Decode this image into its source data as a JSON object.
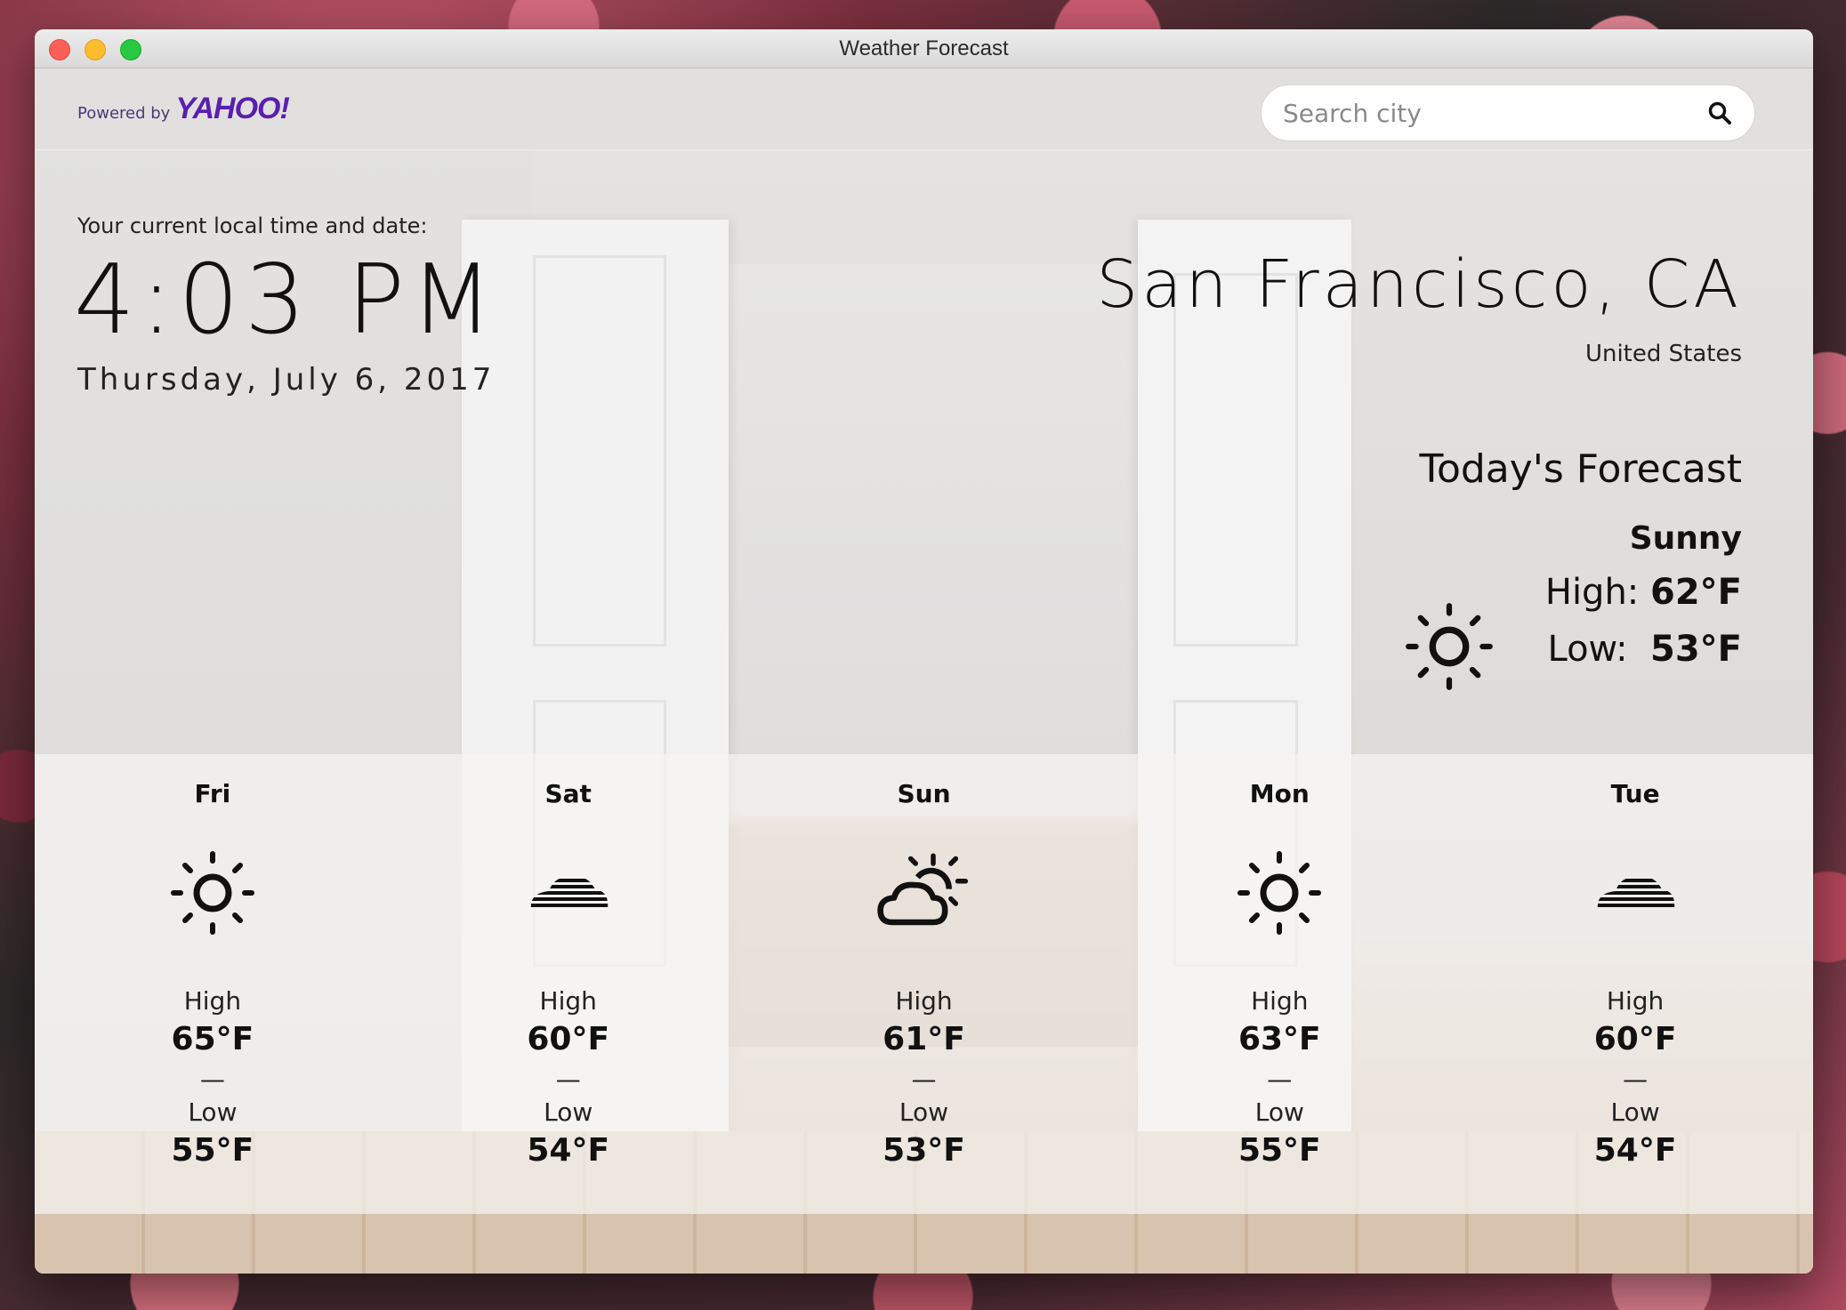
{
  "window": {
    "title": "Weather Forecast"
  },
  "header": {
    "powered_by": "Powered by",
    "brand": "YAHOO!",
    "search": {
      "placeholder": "Search city",
      "value": ""
    }
  },
  "local": {
    "label": "Your current local time and date:",
    "time": "4:03 PM",
    "date": "Thursday, July 6, 2017"
  },
  "location": {
    "city": "San Francisco, CA",
    "country": "United States"
  },
  "today": {
    "title": "Today's Forecast",
    "condition": "Sunny",
    "high_label": "High:",
    "high": "62°F",
    "low_label": "Low:",
    "low": "53°F",
    "icon": "sun-icon"
  },
  "forecast": [
    {
      "day": "Fri",
      "icon": "sun-icon",
      "high_label": "High",
      "high": "65°F",
      "dash": "—",
      "low_label": "Low",
      "low": "55°F"
    },
    {
      "day": "Sat",
      "icon": "cloud-icon",
      "high_label": "High",
      "high": "60°F",
      "dash": "—",
      "low_label": "Low",
      "low": "54°F"
    },
    {
      "day": "Sun",
      "icon": "partly-cloudy-icon",
      "high_label": "High",
      "high": "61°F",
      "dash": "—",
      "low_label": "Low",
      "low": "53°F"
    },
    {
      "day": "Mon",
      "icon": "sun-icon",
      "high_label": "High",
      "high": "63°F",
      "dash": "—",
      "low_label": "Low",
      "low": "55°F"
    },
    {
      "day": "Tue",
      "icon": "cloud-icon",
      "high_label": "High",
      "high": "60°F",
      "dash": "—",
      "low_label": "Low",
      "low": "54°F"
    }
  ],
  "colors": {
    "brand": "#5a1fb0",
    "text": "#111111"
  }
}
